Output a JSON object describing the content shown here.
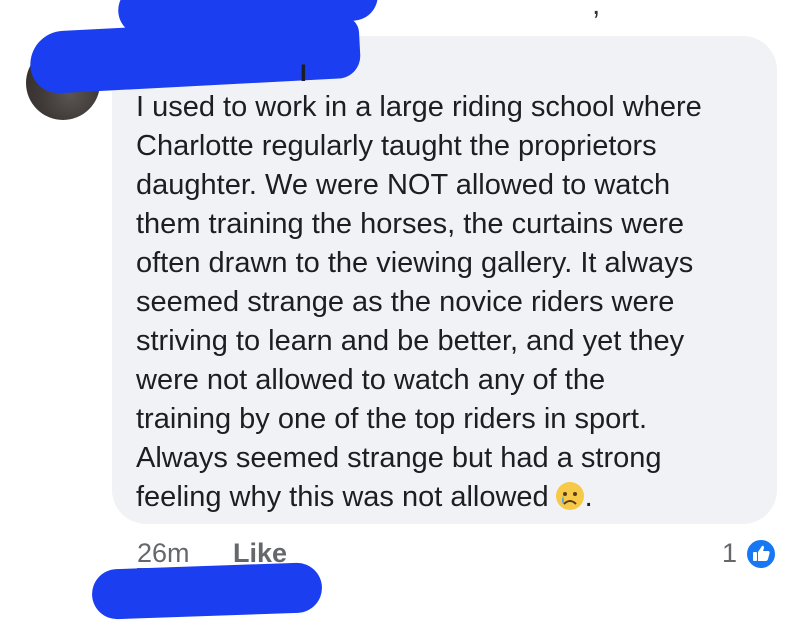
{
  "post": {
    "comma_fragment": ",",
    "author_name_tail": "I"
  },
  "comment": {
    "text": "I used to work in a large riding school where\nCharlotte regularly taught the proprietors\ndaughter. We were NOT allowed to watch\nthem training the horses, the curtains were\noften drawn to the viewing gallery. It always\nseemed strange as the novice riders were\nstriving to learn and be better, and yet they\nwere not allowed to watch any of the\ntraining by one of the top riders in sport.\nAlways seemed strange but had a strong\nfeeling why this was not allowed",
    "trailing": ".",
    "emoji": "sad-tear-emoji"
  },
  "footer": {
    "time": "26m",
    "like_label": "Like",
    "reaction_count": "1",
    "reaction_icon": "thumbs-up-icon",
    "accent": "#1877f2"
  },
  "redaction_color": "#1a3ef0"
}
